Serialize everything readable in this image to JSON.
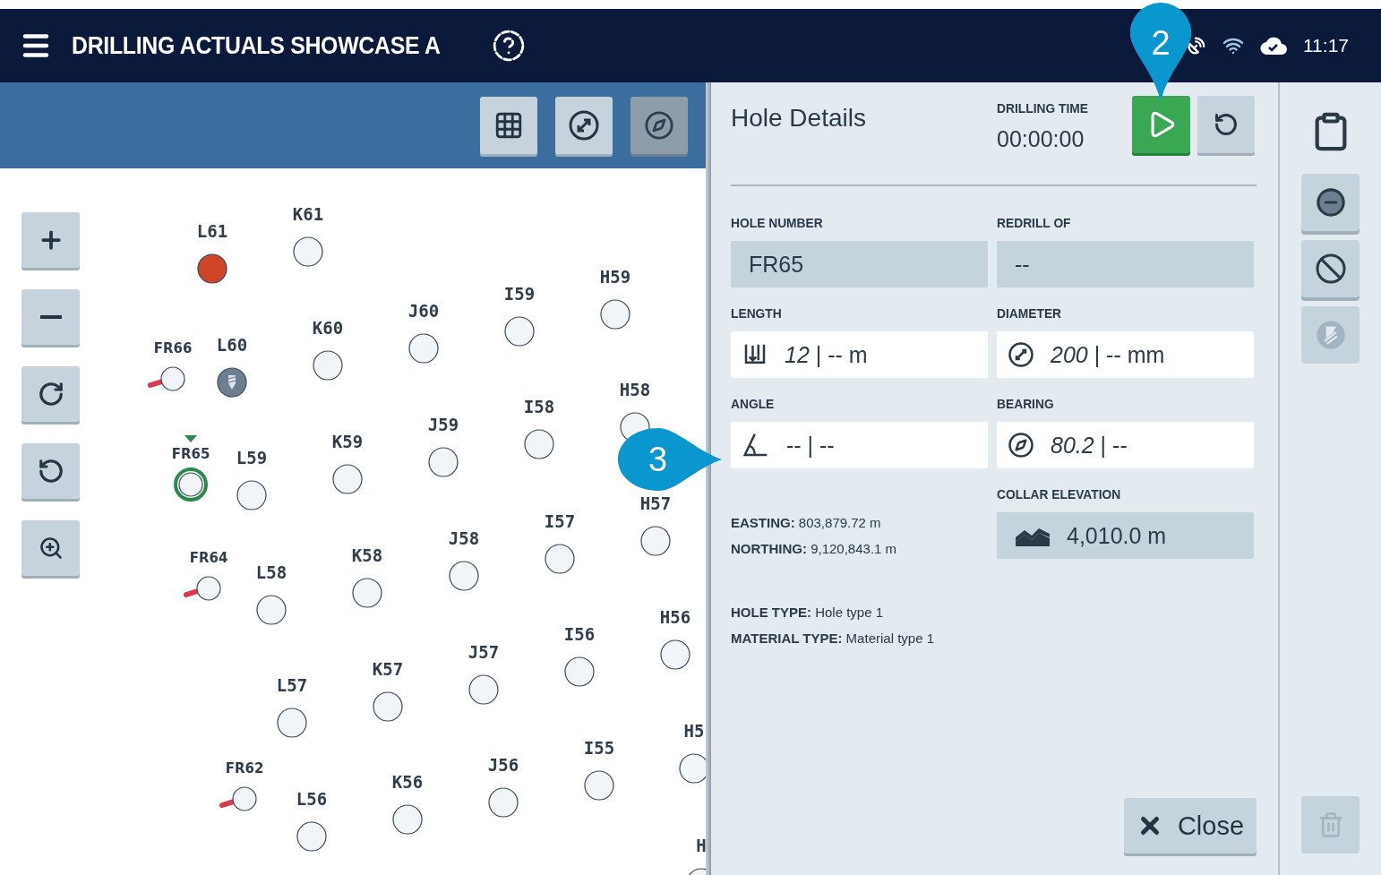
{
  "header": {
    "title": "DRILLING ACTUALS SHOWCASE A",
    "time": "11:17"
  },
  "map_toolbar": [
    {
      "kind": "grid",
      "selected": false
    },
    {
      "kind": "move",
      "selected": false
    },
    {
      "kind": "compass",
      "selected": true
    }
  ],
  "map_controls": [
    {
      "kind": "zoom-in"
    },
    {
      "kind": "zoom-out"
    },
    {
      "kind": "rotate-cw"
    },
    {
      "kind": "rotate-ccw"
    },
    {
      "kind": "zoom-area"
    }
  ],
  "holes": [
    {
      "label": "L61",
      "kind": "drilled"
    },
    {
      "label": "K61",
      "kind": "pending"
    },
    {
      "label": "H59",
      "kind": "pending"
    },
    {
      "label": "I59",
      "kind": "pending"
    },
    {
      "label": "J60",
      "kind": "pending"
    },
    {
      "label": "K60",
      "kind": "pending"
    },
    {
      "label": "FR66",
      "kind": "redrill"
    },
    {
      "label": "L60",
      "kind": "drilling"
    },
    {
      "label": "H58",
      "kind": "pending"
    },
    {
      "label": "I58",
      "kind": "pending"
    },
    {
      "label": "J59",
      "kind": "pending"
    },
    {
      "label": "K59",
      "kind": "pending"
    },
    {
      "label": "FR65",
      "kind": "redrill",
      "selected": true
    },
    {
      "label": "L59",
      "kind": "pending"
    },
    {
      "label": "H57",
      "kind": "pending"
    },
    {
      "label": "I57",
      "kind": "pending"
    },
    {
      "label": "J58",
      "kind": "pending"
    },
    {
      "label": "K58",
      "kind": "pending"
    },
    {
      "label": "FR64",
      "kind": "redrill"
    },
    {
      "label": "L58",
      "kind": "pending"
    },
    {
      "label": "H56",
      "kind": "pending"
    },
    {
      "label": "I56",
      "kind": "pending"
    },
    {
      "label": "J57",
      "kind": "pending"
    },
    {
      "label": "K57",
      "kind": "pending"
    },
    {
      "label": "L57",
      "kind": "pending"
    },
    {
      "label": "H5",
      "kind": "pending"
    },
    {
      "label": "I55",
      "kind": "pending"
    },
    {
      "label": "J56",
      "kind": "pending"
    },
    {
      "label": "K56",
      "kind": "pending"
    },
    {
      "label": "FR62",
      "kind": "redrill"
    },
    {
      "label": "L56",
      "kind": "pending"
    },
    {
      "label": "H",
      "kind": "pending"
    }
  ],
  "details": {
    "title": "Hole Details",
    "drilling_time": {
      "label": "DRILLING TIME",
      "value": "00:00:00"
    },
    "fields": [
      {
        "label": "HOLE NUMBER",
        "value": "FR65",
        "kind": "readonly"
      },
      {
        "label": "REDRILL OF",
        "value": "--",
        "kind": "readonly"
      },
      {
        "label": "LENGTH",
        "value": "*12* | -- m",
        "kind": "length"
      },
      {
        "label": "DIAMETER",
        "value": "*200* | -- mm",
        "kind": "diameter"
      },
      {
        "label": "ANGLE",
        "value": "-- | --",
        "kind": "angle"
      },
      {
        "label": "BEARING",
        "value": "*80.2* | --",
        "kind": "bearing"
      }
    ],
    "coordinates": [
      "**EASTING:** 803,879.72 m",
      "**NORTHING:** 9,120,843.1 m"
    ],
    "collar_elevation": {
      "label": "COLLAR ELEVATION",
      "value": "4,010.0 m"
    },
    "types": [
      "**HOLE TYPE:** Hole type 1",
      "**MATERIAL TYPE:** Material type 1"
    ],
    "close_button": "Close"
  },
  "side_actions": [
    {
      "kind": "abandon",
      "disabled": false
    },
    {
      "kind": "block",
      "disabled": false
    },
    {
      "kind": "drill",
      "disabled": true
    },
    {
      "kind": "delete",
      "disabled": true
    }
  ],
  "callouts": [
    {
      "number": "2"
    },
    {
      "number": "3"
    }
  ]
}
